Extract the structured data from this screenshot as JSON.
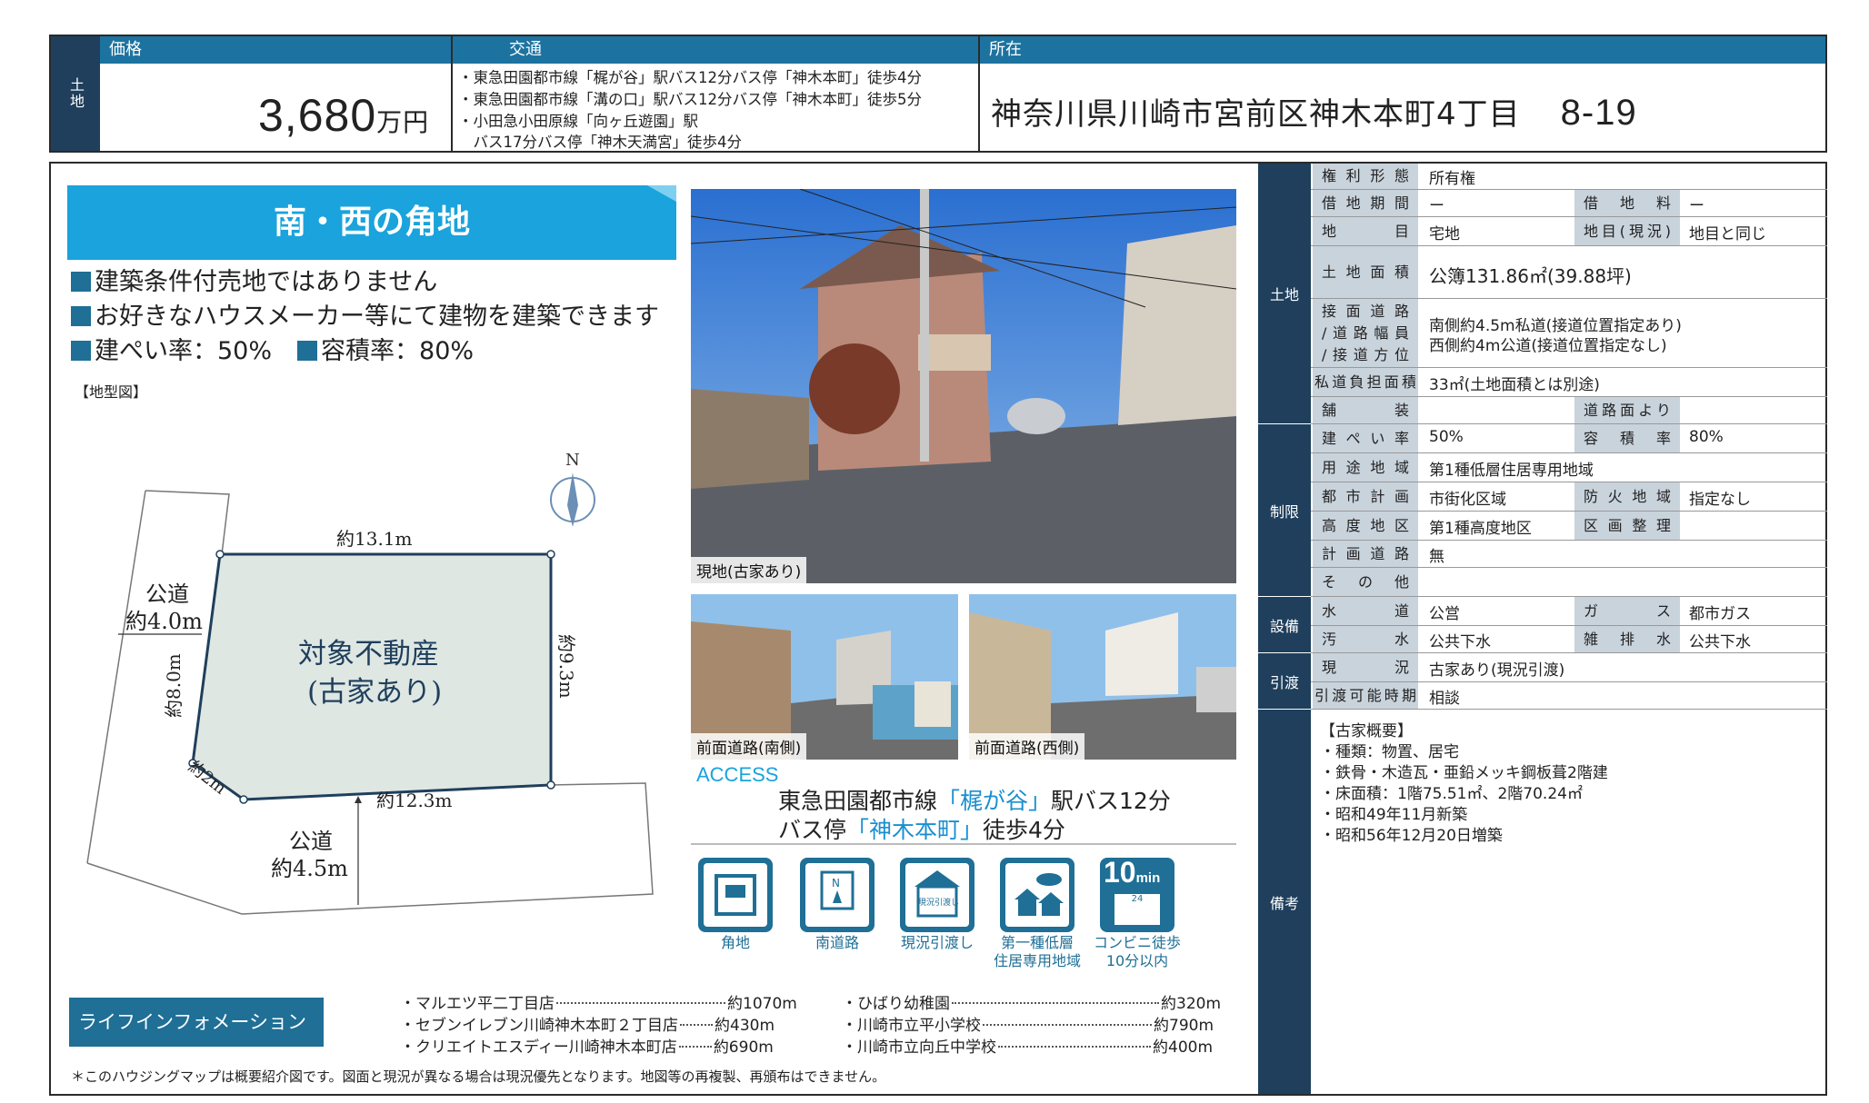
{
  "header": {
    "side_label": "土地",
    "price_label": "価格",
    "access_label": "交通",
    "location_label": "所在",
    "price_value": "3,680",
    "price_unit": "万円",
    "access_lines": [
      "・東急田園都市線「梶が谷」駅バス12分バス停「神木本町」徒歩4分",
      "・東急田園都市線「溝の口」駅バス12分バス停「神木本町」徒歩5分",
      "・小田急小田原線「向ヶ丘遊園」駅",
      "　バス17分バス停「神木天満宮」徒歩4分"
    ],
    "address": "神奈川県川崎市宮前区神木本町4丁目",
    "address_num": "8-19"
  },
  "left": {
    "banner": "南・西の角地",
    "bullets": [
      "建築条件付売地ではありません",
      "お好きなハウスメーカー等にて建物を建築できます"
    ],
    "ratio1": "建ぺい率：50%",
    "ratio2": "容積率：80%",
    "map_label": "【地型図】",
    "map": {
      "north": "N",
      "top_len": "約13.1m",
      "right_len": "約9.3m",
      "left_len": "約8.0m",
      "corner_len": "約2m",
      "bottom_len": "約12.3m",
      "west_road_1": "公道",
      "west_road_2": "約4.0m",
      "south_road_1": "公道",
      "south_road_2": "約4.5m",
      "subject_1": "対象不動産",
      "subject_2": "(古家あり)"
    }
  },
  "photos": {
    "main_caption": "現地(古家あり)",
    "south_caption": "前面道路(南側)",
    "west_caption": "前面道路(西側)"
  },
  "access": {
    "title": "ACCESS",
    "line1_a": "東急田園都市線",
    "line1_b": "「梶が谷」",
    "line1_c": "駅バス12分",
    "line2_a": "バス停",
    "line2_b": "「神木本町」",
    "line2_c": "徒歩4分"
  },
  "features": [
    {
      "label": "角地",
      "icon": "corner-lot-icon"
    },
    {
      "label": "南道路",
      "icon": "compass-icon"
    },
    {
      "label": "現況引渡し",
      "icon": "house-handover-icon"
    },
    {
      "label": "第一種低層\n住居専用地域",
      "icon": "residential-zone-icon"
    },
    {
      "label": "コンビニ徒歩\n10分以内",
      "icon": "convenience-store-icon"
    }
  ],
  "feature_icon_texts": {
    "handover": "現況引渡し",
    "minutes": "10",
    "min_unit": "min",
    "store": "24"
  },
  "life": {
    "tag": "ライフインフォメーション",
    "left_items": [
      {
        "name": "・マルエツ平二丁目店",
        "dist": "約1070m"
      },
      {
        "name": "・セブンイレブン川崎神木本町２丁目店",
        "dist": "約430m"
      },
      {
        "name": "・クリエイトエスディー川崎神木本町店",
        "dist": "約690m"
      }
    ],
    "right_items": [
      {
        "name": "・ひばり幼稚園",
        "dist": "約320m"
      },
      {
        "name": "・川崎市立平小学校",
        "dist": "約790m"
      },
      {
        "name": "・川崎市立向丘中学校",
        "dist": "約400m"
      }
    ],
    "note": "＊このハウジングマップは概要紹介図です。図面と現況が異なる場合は現況優先となります。地図等の再複製、再頒布はできません。"
  },
  "table": {
    "categories": {
      "land": "土地",
      "restrict": "制限",
      "facility": "設備",
      "handover": "引渡",
      "remarks": "備考"
    },
    "rights_h": "権利形態",
    "rights_v": "所有権",
    "lease_h": "借地期間",
    "lease_v": "ー",
    "rent_h": "借地料",
    "rent_v": "ー",
    "chimoku_h": "地目",
    "chimoku_v": "宅地",
    "chimoku_now_h": "地目(現況)",
    "chimoku_now_v": "地目と同じ",
    "area_h": "土地面積",
    "area_v": "公簿131.86㎡(39.88坪)",
    "road_h1": "接面道路",
    "road_h2": "/道路幅員",
    "road_h3": "/接道方位",
    "road_v1": "南側約4.5m私道(接道位置指定あり)",
    "road_v2": "西側約4m公道(接道位置指定なし)",
    "private_h": "私道負担面積",
    "private_v": "33㎡(土地面積とは別途)",
    "pave_h": "舗装",
    "pave_v": "",
    "road_surface_h": "道路面より",
    "road_surface_v": "",
    "bcr_h": "建ぺい率",
    "bcr_v": "50%",
    "far_h": "容積率",
    "far_v": "80%",
    "use_h": "用途地域",
    "use_v": "第1種低層住居専用地域",
    "plan_h": "都市計画",
    "plan_v": "市街化区域",
    "fire_h": "防火地域",
    "fire_v": "指定なし",
    "height_h": "高度地区",
    "height_v": "第1種高度地区",
    "lr_h": "区画整理",
    "lr_v": "",
    "planned_road_h": "計画道路",
    "planned_road_v": "無",
    "other_h": "その他",
    "other_v": "",
    "water_h": "水道",
    "water_v": "公営",
    "gas_h": "ガス",
    "gas_v": "都市ガス",
    "sewage_h": "汚水",
    "sewage_v": "公共下水",
    "drain_h": "雑排水",
    "drain_v": "公共下水",
    "status_h": "現況",
    "status_v": "古家あり(現況引渡)",
    "timing_h": "引渡可能時期",
    "timing_v": "相談",
    "remarks": "【古家概要】\n・種類：物置、居宅\n・鉄骨・木造瓦・亜鉛メッキ鋼板葺2階建\n・床面積：1階75.51㎡、2階70.24㎡\n・昭和49年11月新築\n・昭和56年12月20日増築"
  },
  "colors": {
    "navy": "#1f3f5c",
    "blue": "#1d73a0",
    "banner": "#1aa3dc",
    "header_cell": "#c9d3dc"
  }
}
